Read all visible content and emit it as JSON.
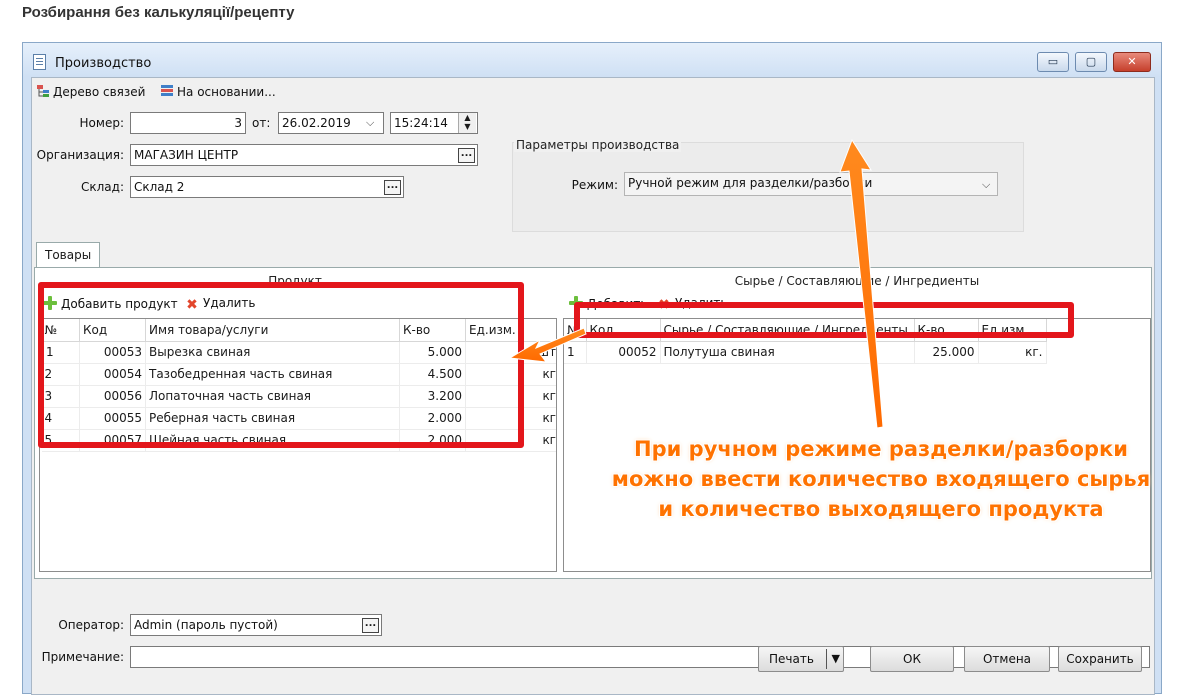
{
  "page_heading": "Розбирання без калькуляції/рецепту",
  "window": {
    "title": "Производство",
    "minimize": "▭",
    "maximize": "▢",
    "close": "✕"
  },
  "toolbar": {
    "tree_label": "Дерево связей",
    "based_on_label": "На основании..."
  },
  "form": {
    "number_label": "Номер:",
    "number_value": "3",
    "from_label": "от:",
    "date_value": "26.02.2019",
    "time_value": "15:24:14",
    "org_label": "Организация:",
    "org_value": "МАГАЗИН ЦЕНТР",
    "warehouse_label": "Склад:",
    "warehouse_value": "Склад 2"
  },
  "params": {
    "group_title": "Параметры производства",
    "mode_label": "Режим:",
    "mode_value": "Ручной режим для разделки/разборки"
  },
  "tabs": [
    {
      "label": "Товары"
    }
  ],
  "products": {
    "title": "Продукт",
    "add_label": "Добавить продукт",
    "delete_label": "Удалить",
    "columns": [
      "№",
      "Код",
      "Имя товара/услуги",
      "К-во",
      "Ед.изм."
    ],
    "rows": [
      {
        "n": "1",
        "code": "00053",
        "name": "Вырезка свиная",
        "qty": "5.000",
        "unit": "шт"
      },
      {
        "n": "2",
        "code": "00054",
        "name": "Тазобедренная часть свиная",
        "qty": "4.500",
        "unit": "кг"
      },
      {
        "n": "3",
        "code": "00056",
        "name": "Лопаточная часть свиная",
        "qty": "3.200",
        "unit": "кг"
      },
      {
        "n": "4",
        "code": "00055",
        "name": "Реберная часть свиная",
        "qty": "2.000",
        "unit": "кг"
      },
      {
        "n": "5",
        "code": "00057",
        "name": "Шейная часть свиная",
        "qty": "2.000",
        "unit": "кг"
      }
    ]
  },
  "raw": {
    "title": "Сырье / Составляющие / Ингредиенты",
    "add_label": "Добавить",
    "delete_label": "Удалить",
    "columns": [
      "№",
      "Код",
      "Сырье / Составляющие / Ингредиенты",
      "К-во",
      "Ед.изм."
    ],
    "rows": [
      {
        "n": "1",
        "code": "00052",
        "name": "Полутуша свиная",
        "qty": "25.000",
        "unit": "кг."
      }
    ]
  },
  "footer": {
    "operator_label": "Оператор:",
    "operator_value": "Admin (пароль пустой)",
    "note_label": "Примечание:",
    "note_value": "",
    "print_label": "Печать",
    "ok_label": "ОК",
    "cancel_label": "Отмена",
    "save_label": "Сохранить"
  },
  "annotation": {
    "line1": "При ручном режиме разделки/разборки",
    "line2": "можно ввести количество входящего сырья",
    "line3": "и количество выходящего продукта"
  },
  "colors": {
    "highlight": "#e3161b",
    "annotation": "#ff7200",
    "add_icon": "#6cbf3c",
    "delete_icon": "#e2462c"
  }
}
